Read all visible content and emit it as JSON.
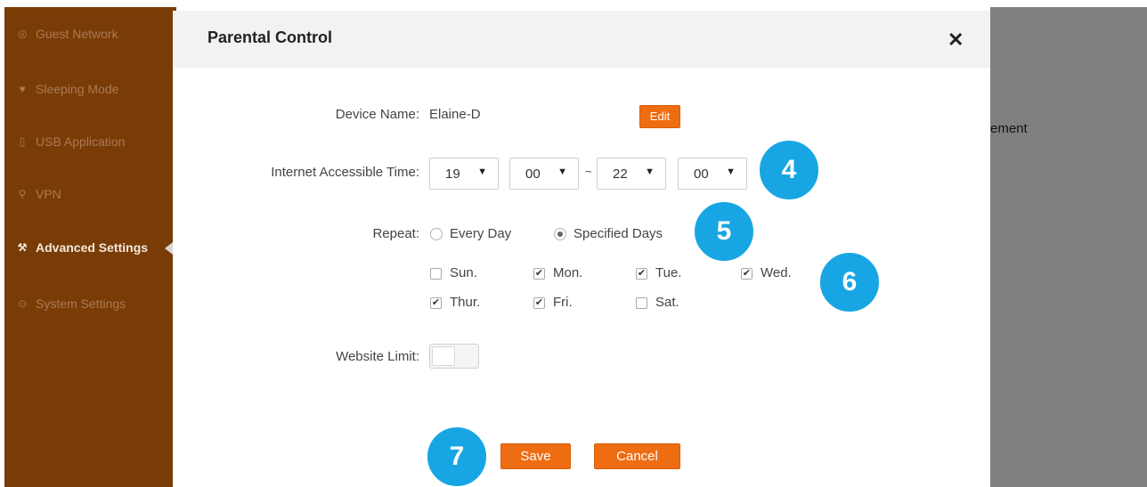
{
  "sidebar": {
    "items": [
      {
        "label": "Guest Network",
        "icon": "guest-network-icon"
      },
      {
        "label": "Sleeping Mode",
        "icon": "sleeping-mode-icon"
      },
      {
        "label": "USB Application",
        "icon": "usb-icon"
      },
      {
        "label": "VPN",
        "icon": "vpn-icon"
      },
      {
        "label": "Advanced Settings",
        "icon": "advanced-settings-icon"
      },
      {
        "label": "System Settings",
        "icon": "system-settings-icon"
      }
    ],
    "active_label": "Advanced Settings"
  },
  "background": {
    "partial_text": "ement"
  },
  "modal": {
    "title": "Parental Control",
    "close_symbol": "✕",
    "device_name_label": "Device Name:",
    "device_name_value": "Elaine-D",
    "edit_label": "Edit",
    "time_label": "Internet Accessible Time:",
    "time": {
      "start_hour": "19",
      "start_minute": "00",
      "separator": "~",
      "end_hour": "22",
      "end_minute": "00"
    },
    "repeat_label": "Repeat:",
    "repeat_options": [
      {
        "label": "Every Day",
        "selected": false
      },
      {
        "label": "Specified Days",
        "selected": true
      }
    ],
    "days": [
      {
        "label": "Sun.",
        "checked": false
      },
      {
        "label": "Mon.",
        "checked": true
      },
      {
        "label": "Tue.",
        "checked": true
      },
      {
        "label": "Wed.",
        "checked": true
      },
      {
        "label": "Thur.",
        "checked": true
      },
      {
        "label": "Fri.",
        "checked": true
      },
      {
        "label": "Sat.",
        "checked": false
      }
    ],
    "website_limit_label": "Website Limit:",
    "website_limit_on": false,
    "save_label": "Save",
    "cancel_label": "Cancel"
  },
  "callouts": [
    "4",
    "5",
    "6",
    "7"
  ],
  "colors": {
    "sidebar": "#7a3c06",
    "accent": "#ee6d12",
    "callout": "#17a6e3",
    "overlay": "#808080"
  }
}
